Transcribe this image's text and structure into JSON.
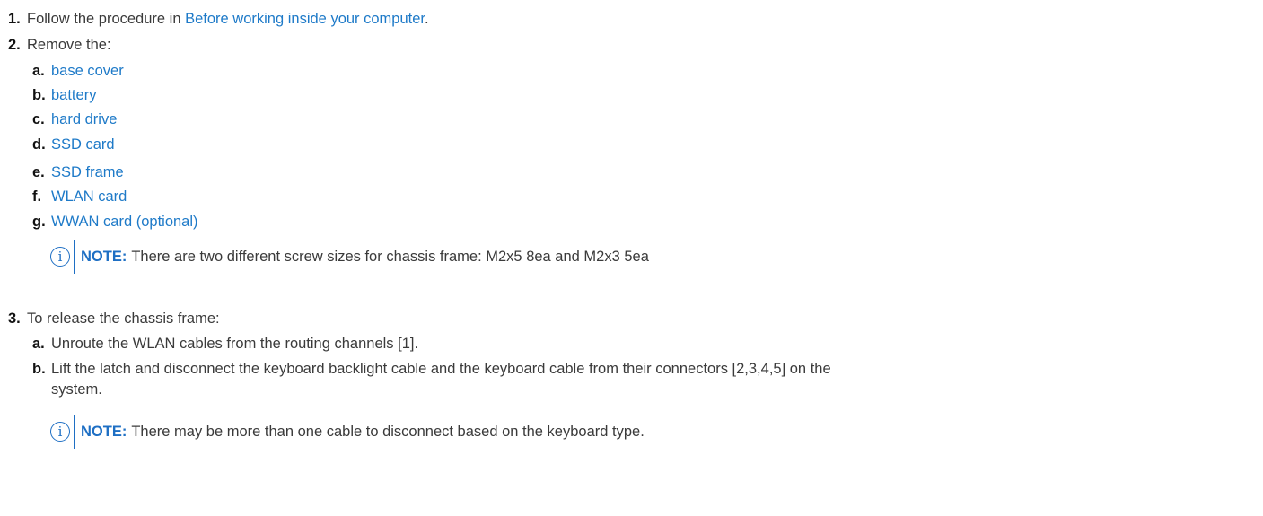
{
  "steps": [
    {
      "num": "1.",
      "prefix": "Follow the procedure in ",
      "link": "Before working inside your computer",
      "suffix": "."
    },
    {
      "num": "2.",
      "text": "Remove the:",
      "items": [
        {
          "letter": "a.",
          "link": "base cover"
        },
        {
          "letter": "b.",
          "link": "battery"
        },
        {
          "letter": "c.",
          "link": "hard drive"
        },
        {
          "letter": "d.",
          "link": "SSD card"
        },
        {
          "letter": "e.",
          "link": "SSD frame"
        },
        {
          "letter": "f.",
          "link": "WLAN card"
        },
        {
          "letter": "g.",
          "link": "WWAN card (optional)"
        }
      ],
      "note": {
        "label": "NOTE:",
        "text": "There are two different screw sizes for chassis frame: M2x5 8ea and M2x3 5ea"
      }
    },
    {
      "num": "3.",
      "text": "To release the chassis frame:",
      "items": [
        {
          "letter": "a.",
          "text": "Unroute the WLAN cables from the routing channels [1]."
        },
        {
          "letter": "b.",
          "text": "Lift the latch and disconnect the keyboard backlight cable and the keyboard cable from their connectors [2,3,4,5] on the",
          "text2": "system."
        }
      ],
      "note": {
        "label": "NOTE:",
        "text": "There may be more than one cable to disconnect based on the keyboard type."
      }
    }
  ],
  "icons": {
    "note": "info-icon"
  }
}
